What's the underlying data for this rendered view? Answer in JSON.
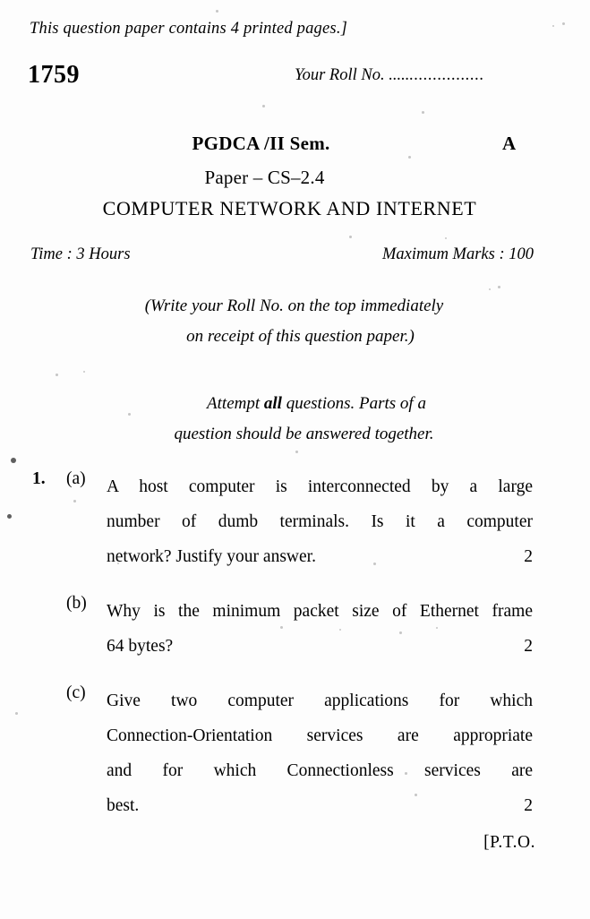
{
  "document": {
    "printed_pages_note": "This question paper contains 4 printed pages.]",
    "paper_code": "1759",
    "roll_no_label": "Your Roll No. .....",
    "roll_no_dots": "................",
    "course": "PGDCA /II Sem.",
    "series_letter": "A",
    "paper_number": "Paper – CS–2.4",
    "subject": "COMPUTER NETWORK AND INTERNET",
    "time": "Time : 3 Hours",
    "maximum_marks": "Maximum Marks : 100",
    "instruction_line_1": "(Write your Roll No. on the top immediately",
    "instruction_line_2": "on receipt of this question paper.)",
    "attempt_line_1_pre": "Attempt ",
    "attempt_line_1_bold": "all",
    "attempt_line_1_post": " questions. Parts of a",
    "attempt_line_2": "question should be answered together.",
    "footer": "[P.T.O."
  },
  "questions": [
    {
      "number": "1.",
      "label": "(a)",
      "lines": [
        "A host  computer is interconnected by a  large",
        "number of dumb terminals. Is it a computer"
      ],
      "last_line": "network? Justify your  answer.",
      "marks": "2"
    },
    {
      "number": "",
      "label": "(b)",
      "lines": [
        "Why is the minimum packet size of Ethernet frame"
      ],
      "last_line": "64 bytes?",
      "marks": "2"
    },
    {
      "number": "",
      "label": "(c)",
      "lines": [
        "Give two computer applications for which",
        "Connection-Orientation services are appropriate",
        "and for which Connectionless  services are"
      ],
      "last_line": "best.",
      "marks": "2"
    }
  ]
}
